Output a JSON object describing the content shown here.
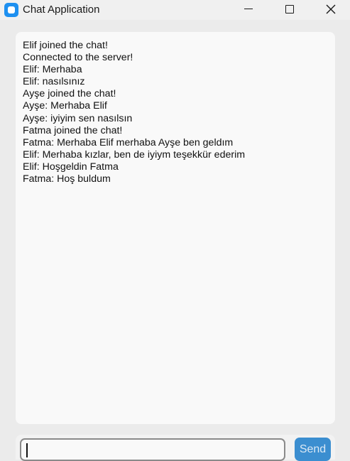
{
  "window": {
    "title": "Chat Application",
    "icon": "app-icon"
  },
  "chat": {
    "messages": [
      "Elif joined the chat!",
      "Connected to the server!",
      "Elif: Merhaba",
      "Elif: nasılsınız",
      "Ayşe joined the chat!",
      "Ayşe: Merhaba Elif",
      "Ayşe: iyiyim sen nasılsın",
      "Fatma joined the chat!",
      "Fatma: Merhaba Elif merhaba Ayşe ben geldım",
      "Elif: Merhaba kızlar, ben de iyiym teşekkür ederim",
      "Elif: Hoşgeldin Fatma",
      "Fatma: Hoş buldum"
    ]
  },
  "composer": {
    "input_value": "",
    "send_label": "Send"
  },
  "colors": {
    "accent": "#3b8ed0",
    "background": "#ebebeb",
    "chat_background": "#f9f9f9"
  }
}
